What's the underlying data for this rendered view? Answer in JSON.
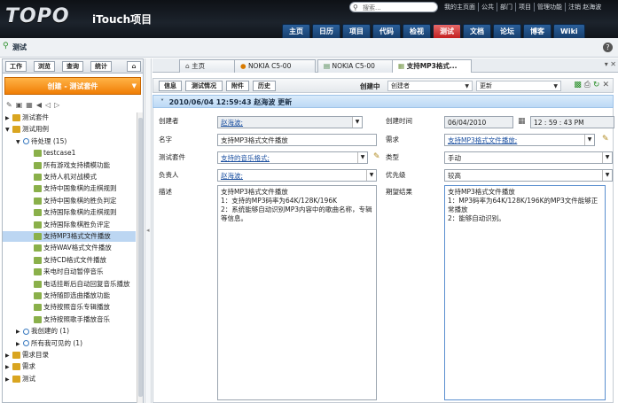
{
  "header": {
    "logo": "TOPO",
    "app_title": "iTouch项目",
    "search_placeholder": "搜索...",
    "top_links": [
      "我的主页面",
      "公共",
      "部门",
      "项目",
      "管理功能",
      "注销 赵海波"
    ],
    "nav_tabs": [
      "主页",
      "日历",
      "项目",
      "代码",
      "检视",
      "测试",
      "文档",
      "论坛",
      "博客",
      "Wiki"
    ],
    "active_tab": "测试"
  },
  "subheader": {
    "title": "测试"
  },
  "left": {
    "tabs": [
      "工作",
      "浏览",
      "查询",
      "统计"
    ],
    "create_button": "创建 - 测试套件",
    "tree": [
      {
        "label": "测试套件",
        "indent": 0,
        "icon": "folder"
      },
      {
        "label": "测试用例",
        "indent": 0,
        "icon": "folder",
        "expanded": true
      },
      {
        "label": "待处理 (15)",
        "indent": 1,
        "icon": "search"
      },
      {
        "label": "testcase1",
        "indent": 2,
        "icon": "case"
      },
      {
        "label": "所有游戏支持横模功能",
        "indent": 2,
        "icon": "case"
      },
      {
        "label": "支持人机对战模式",
        "indent": 2,
        "icon": "case"
      },
      {
        "label": "支持中国象棋的走棋规则",
        "indent": 2,
        "icon": "case"
      },
      {
        "label": "支持中国象棋的胜负判定",
        "indent": 2,
        "icon": "case"
      },
      {
        "label": "支持国际象棋的走棋规则",
        "indent": 2,
        "icon": "case"
      },
      {
        "label": "支持国际象棋胜负评定",
        "indent": 2,
        "icon": "case"
      },
      {
        "label": "支持MP3格式文件播放",
        "indent": 2,
        "icon": "case",
        "selected": true
      },
      {
        "label": "支持WAV格式文件播放",
        "indent": 2,
        "icon": "case"
      },
      {
        "label": "支持CD格式文件播放",
        "indent": 2,
        "icon": "case"
      },
      {
        "label": "来电时自动暂停音乐",
        "indent": 2,
        "icon": "case"
      },
      {
        "label": "电话挂断后自动回复音乐播放",
        "indent": 2,
        "icon": "case"
      },
      {
        "label": "支持随即选曲播放功能",
        "indent": 2,
        "icon": "case"
      },
      {
        "label": "支持按照音乐专辑播放",
        "indent": 2,
        "icon": "case"
      },
      {
        "label": "支持按照歌手播放音乐",
        "indent": 2,
        "icon": "case"
      },
      {
        "label": "我创建的 (1)",
        "indent": 1,
        "icon": "search"
      },
      {
        "label": "所有我可见的 (1)",
        "indent": 1,
        "icon": "search"
      },
      {
        "label": "需求目录",
        "indent": 0,
        "icon": "folder"
      },
      {
        "label": "需求",
        "indent": 0,
        "icon": "folder"
      },
      {
        "label": "测试",
        "indent": 0,
        "icon": "folder"
      }
    ]
  },
  "right": {
    "tabs": [
      "主页",
      "NOKIA C5-00",
      "NOKIA C5-00",
      "支持MP3格式..."
    ],
    "sub_tabs": [
      "信息",
      "测试情况",
      "附件",
      "历史"
    ],
    "status_label": "创建中",
    "creator_dropdown": "创建者",
    "update_dropdown": "更新",
    "record_title": "2010/06/04 12:59:43 赵海波 更新",
    "form": {
      "creator_label": "创建者",
      "creator_value": "赵海波;",
      "created_time_label": "创建时间",
      "created_date": "06/04/2010",
      "created_time": "12 : 59 : 43 PM",
      "name_label": "名字",
      "name_value": "支持MP3格式文件播放",
      "requirement_label": "需求",
      "requirement_value": "支持MP3格式文件播放;",
      "suite_label": "测试套件",
      "suite_value": "支持的音乐格式;",
      "type_label": "类型",
      "type_value": "手动",
      "owner_label": "负责人",
      "owner_value": "赵海波;",
      "priority_label": "优先级",
      "priority_value": "较高",
      "desc_label": "描述",
      "desc_lines": [
        "支持MP3格式文件播放",
        "1：支持的MP3码率为64K/128K/196K",
        "2：系统能够自动识别MP3内容中的歌曲名称，专辑等信息。"
      ],
      "expected_label": "期望结果",
      "expected_lines": [
        "支持MP3格式文件播放",
        "1：MP3码率为64K/128K/196K的MP3文件能够正常播放",
        "2：能够自动识别。"
      ]
    }
  }
}
